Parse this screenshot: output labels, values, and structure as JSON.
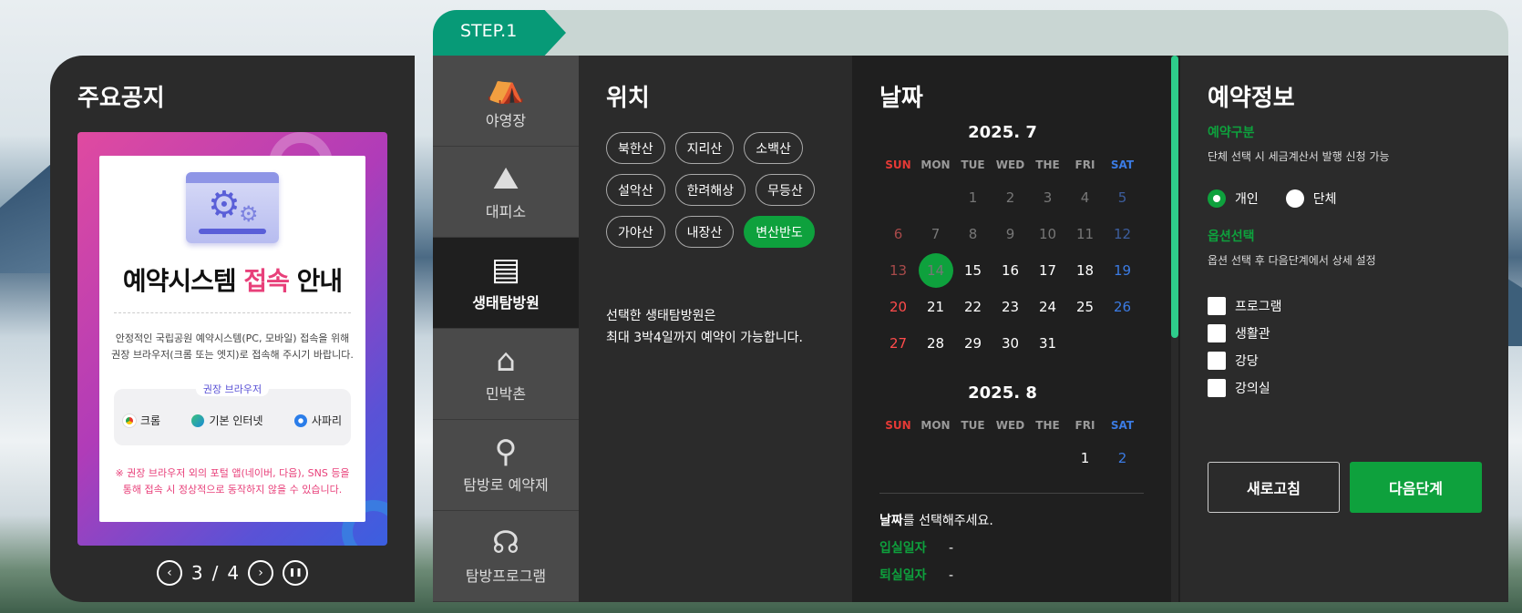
{
  "notice": {
    "title": "주요공지",
    "banner": {
      "headline_part1": "예약시스템 ",
      "headline_highlight": "접속",
      "headline_part2": " 안내",
      "body_line1": "안정적인 국립공원 예약시스템(PC, 모바일) 접속을 위해",
      "body_line2": "권장 브라우저(크롬 또는 엣지)로  접속해 주시기 바랍니다.",
      "browser_label": "권장 브라우저",
      "browsers": [
        {
          "name": "크롬",
          "color": "#e33b2e"
        },
        {
          "name": "기본 인터넷",
          "color": "#1a8ad8"
        },
        {
          "name": "사파리",
          "color": "#2b7de9"
        }
      ],
      "warning_line1": "※ 권장 브라우저 외의 포털 앱(네이버, 다음), SNS 등을",
      "warning_line2": "통해 접속 시 정상적으로 동작하지 않을 수 있습니다."
    },
    "pager": {
      "current": "3",
      "separator": "/",
      "total": "4",
      "prev": "‹",
      "next": "›",
      "pause": "❚❚"
    }
  },
  "step": {
    "label": "STEP.1"
  },
  "nav": {
    "items": [
      {
        "label": "야영장",
        "icon": "⛺"
      },
      {
        "label": "대피소",
        "icon": "⛰"
      },
      {
        "label": "생태탐방원",
        "icon": "🏫",
        "active": true
      },
      {
        "label": "민박촌",
        "icon": "🏘"
      },
      {
        "label": "탐방로 예약제",
        "icon": "📍"
      },
      {
        "label": "탐방프로그램",
        "icon": "🎧"
      }
    ]
  },
  "location": {
    "title": "위치",
    "chips": [
      "북한산",
      "지리산",
      "소백산",
      "설악산",
      "한려해상",
      "무등산",
      "가야산",
      "내장산",
      "변산반도"
    ],
    "active_chip": "변산반도",
    "info_line1": "선택한 생태탐방원은",
    "info_line2": "최대 3박4일까지 예약이 가능합니다."
  },
  "date": {
    "title": "날짜",
    "weekdays": [
      "SUN",
      "MON",
      "TUE",
      "WED",
      "THE",
      "FRI",
      "SAT"
    ],
    "july": {
      "title": "2025. 7",
      "days": [
        "",
        "",
        "1",
        "2",
        "3",
        "4",
        "5",
        "6",
        "7",
        "8",
        "9",
        "10",
        "11",
        "12",
        "13",
        "14",
        "15",
        "16",
        "17",
        "18",
        "19",
        "20",
        "21",
        "22",
        "23",
        "24",
        "25",
        "26",
        "27",
        "28",
        "29",
        "30",
        "31"
      ],
      "past_until": 15,
      "today": "14"
    },
    "august": {
      "title": "2025. 8",
      "days": [
        "",
        "",
        "",
        "",
        "",
        "1",
        "2"
      ]
    },
    "prompt_bold": "날짜",
    "prompt_rest": "를 선택해주세요.",
    "checkin_label": "입실일자",
    "checkin_value": "-",
    "checkout_label": "퇴실일자",
    "checkout_value": "-"
  },
  "reservation": {
    "title": "예약정보",
    "type_label": "예약구분",
    "type_desc": "단체 선택 시 세금계산서 발행 신청 가능",
    "radio_individual": "개인",
    "radio_group": "단체",
    "option_label": "옵션선택",
    "option_desc": "옵션 선택 후 다음단계에서 상세 설정",
    "options": [
      "프로그램",
      "생활관",
      "강당",
      "강의실"
    ],
    "refresh_button": "새로고침",
    "next_button": "다음단계"
  }
}
